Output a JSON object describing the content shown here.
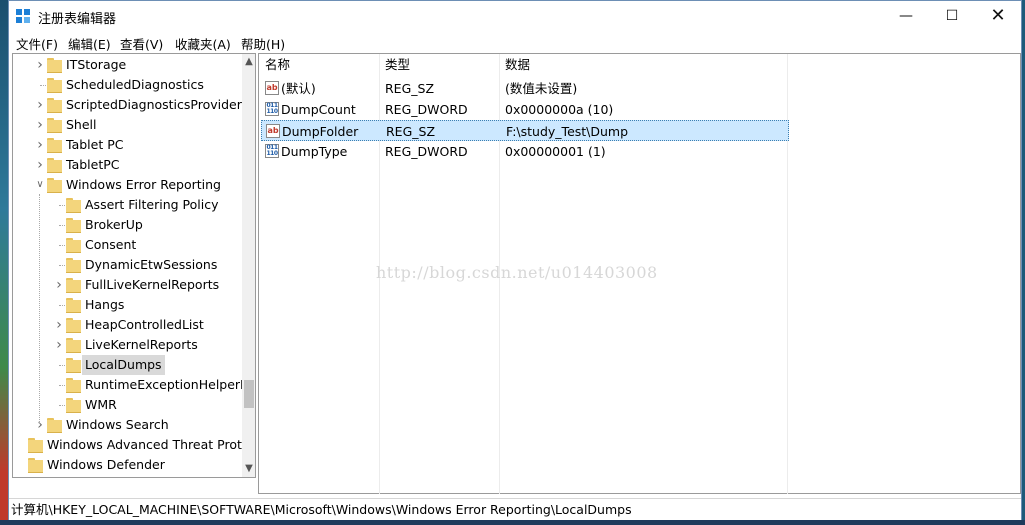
{
  "window": {
    "title": "注册表编辑器"
  },
  "menu": [
    "文件(F)",
    "编辑(E)",
    "查看(V)",
    "收藏夹(A)",
    "帮助(H)"
  ],
  "tree": [
    {
      "label": "ITStorage",
      "expand": "collapsed",
      "level": 1
    },
    {
      "label": "ScheduledDiagnostics",
      "expand": "none",
      "level": 1
    },
    {
      "label": "ScriptedDiagnosticsProvider",
      "expand": "collapsed",
      "level": 1
    },
    {
      "label": "Shell",
      "expand": "collapsed",
      "level": 1
    },
    {
      "label": "Tablet PC",
      "expand": "collapsed",
      "level": 1
    },
    {
      "label": "TabletPC",
      "expand": "collapsed",
      "level": 1
    },
    {
      "label": "Windows Error Reporting",
      "expand": "expanded",
      "level": 1
    },
    {
      "label": "Assert Filtering Policy",
      "expand": "none",
      "level": 2
    },
    {
      "label": "BrokerUp",
      "expand": "none",
      "level": 2
    },
    {
      "label": "Consent",
      "expand": "none",
      "level": 2
    },
    {
      "label": "DynamicEtwSessions",
      "expand": "none",
      "level": 2
    },
    {
      "label": "FullLiveKernelReports",
      "expand": "collapsed",
      "level": 2
    },
    {
      "label": "Hangs",
      "expand": "none",
      "level": 2
    },
    {
      "label": "HeapControlledList",
      "expand": "collapsed",
      "level": 2
    },
    {
      "label": "LiveKernelReports",
      "expand": "collapsed",
      "level": 2
    },
    {
      "label": "LocalDumps",
      "expand": "none",
      "level": 2,
      "selected": true
    },
    {
      "label": "RuntimeExceptionHelperMo",
      "expand": "none",
      "level": 2
    },
    {
      "label": "WMR",
      "expand": "none",
      "level": 2
    },
    {
      "label": "Windows Search",
      "expand": "collapsed",
      "level": 1
    },
    {
      "label": "Windows Advanced Threat Protec",
      "expand": "none",
      "level": 0
    },
    {
      "label": "Windows Defender",
      "expand": "none",
      "level": 0
    }
  ],
  "columns": [
    "名称",
    "类型",
    "数据"
  ],
  "values": [
    {
      "name": "(默认)",
      "type": "REG_SZ",
      "data": "(数值未设置)",
      "icon": "string-value-icon"
    },
    {
      "name": "DumpCount",
      "type": "REG_DWORD",
      "data": "0x0000000a (10)",
      "icon": "binary-value-icon"
    },
    {
      "name": "DumpFolder",
      "type": "REG_SZ",
      "data": "F:\\study_Test\\Dump",
      "icon": "string-value-icon",
      "selected": true
    },
    {
      "name": "DumpType",
      "type": "REG_DWORD",
      "data": "0x00000001 (1)",
      "icon": "binary-value-icon"
    }
  ],
  "icons": {
    "string": "ab",
    "binary": "011 110"
  },
  "watermark": "http://blog.csdn.net/u014403008",
  "status": {
    "path": "计算机\\HKEY_LOCAL_MACHINE\\SOFTWARE\\Microsoft\\Windows\\Windows Error Reporting\\LocalDumps"
  },
  "colors": {
    "selection": "#cce8ff",
    "folder": "#f3d57c",
    "accent": "#1c7fd6"
  }
}
